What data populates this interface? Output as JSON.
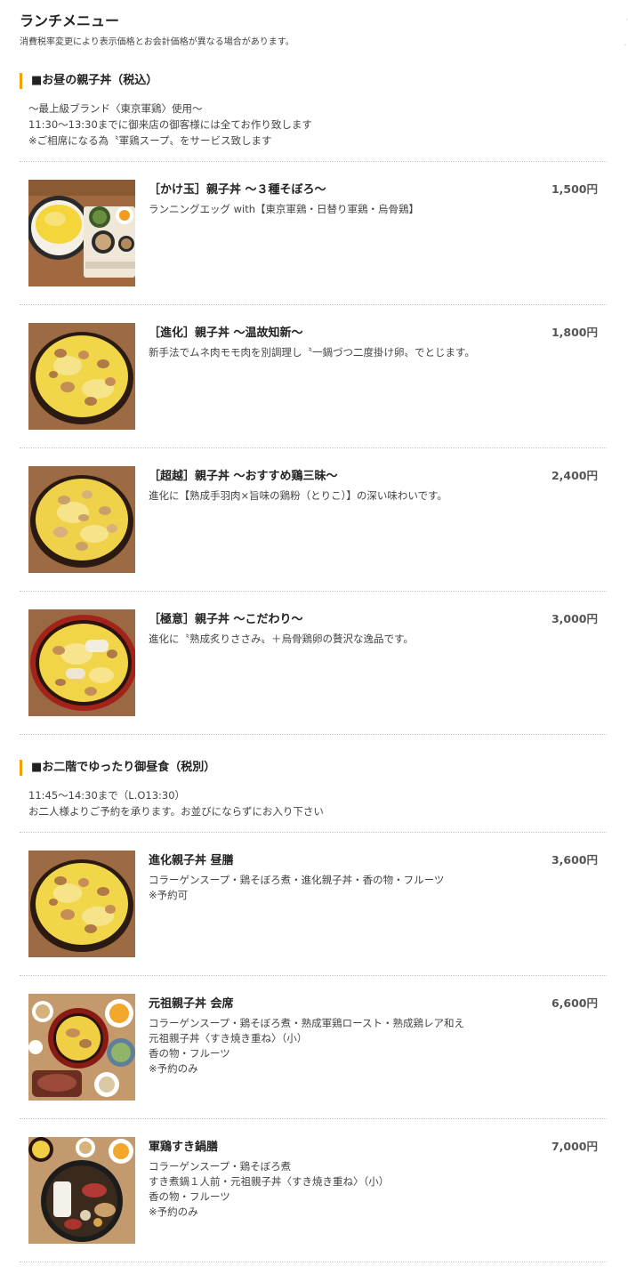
{
  "header": {
    "title": "ランチメニュー",
    "note": "消費税率変更により表示価格とお会計価格が異なる場合があります。"
  },
  "sections": [
    {
      "heading": "■お昼の親子丼（税込）",
      "intro": [
        "〜最上級ブランド〈東京軍鶏〉使用〜",
        "11:30〜13:30までに御来店の御客様には全てお作り致します",
        "※ご相席になる為〝軍鶏スープ〟をサービス致します"
      ],
      "items": [
        {
          "title": "［かけ玉］親子丼 〜３種そぼろ〜",
          "price": "1,500円",
          "desc": [
            "ランニングエッグ with【東京軍鶏・日替り軍鶏・烏骨鶏】"
          ],
          "image": "set-meal-with-scrambled-egg-bowl"
        },
        {
          "title": "［進化］親子丼 〜温故知新〜",
          "price": "1,800円",
          "desc": [
            "新手法でムネ肉モモ肉を別調理し〝一鍋づつ二度掛け卵〟でとじます。"
          ],
          "image": "oyakodon-bowl"
        },
        {
          "title": "［超越］親子丼 〜おすすめ鶏三昧〜",
          "price": "2,400円",
          "desc": [
            "進化に【熟成手羽肉×旨味の鶏粉（とりこ）】の深い味わいです。"
          ],
          "image": "oyakodon-bowl"
        },
        {
          "title": "［極意］親子丼 〜こだわり〜",
          "price": "3,000円",
          "desc": [
            "進化に〝熟成炙りささみ〟＋烏骨鶏卵の贅沢な逸品です。"
          ],
          "image": "oyakodon-red-bowl"
        }
      ]
    },
    {
      "heading": "■お二階でゆったり御昼食（税別）",
      "intro": [
        "11:45〜14:30まで（L.O13:30）",
        "お二人様よりご予約を承ります。お並びにならずにお入り下さい"
      ],
      "items": [
        {
          "title": "進化親子丼 昼膳",
          "price": "3,600円",
          "desc": [
            "コラーゲンスープ・鶏そぼろ煮・進化親子丼・香の物・フルーツ",
            "※予約可"
          ],
          "image": "oyakodon-bowl"
        },
        {
          "title": "元祖親子丼 会席",
          "price": "6,600円",
          "desc": [
            "コラーゲンスープ・鶏そぼろ煮・熟成軍鶏ロースト・熟成鶏レア和え",
            "元祖親子丼〈すき焼き重ね〉（小）",
            "香の物・フルーツ",
            "※予約のみ"
          ],
          "image": "kaiseki-course-set"
        },
        {
          "title": "軍鶏すき鍋膳",
          "price": "7,000円",
          "desc": [
            "コラーゲンスープ・鶏そぼろ煮",
            "すき煮鍋１人前・元祖親子丼〈すき焼き重ね〉（小）",
            "香の物・フルーツ",
            "※予約のみ"
          ],
          "image": "sukiyaki-hotpot-set"
        }
      ]
    }
  ],
  "colors": {
    "accent": "#f0a500",
    "text": "#333333",
    "divider": "#c8c8c8"
  }
}
